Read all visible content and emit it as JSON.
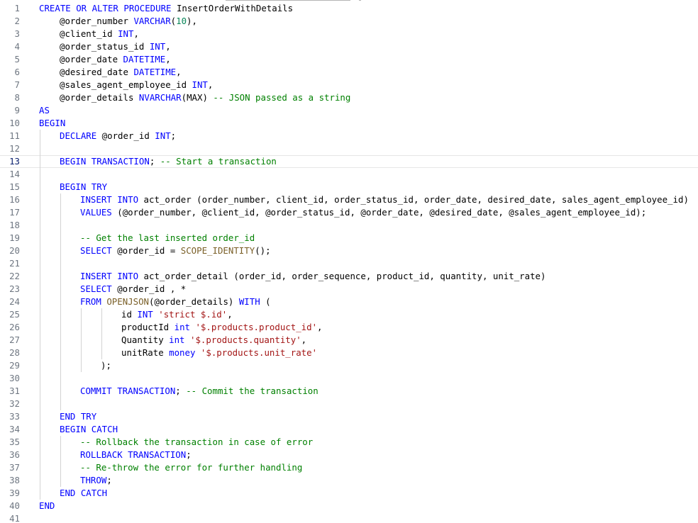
{
  "editor": {
    "current_line": 13,
    "colors": {
      "keyword": "#0000ff",
      "function": "#795e26",
      "number": "#098658",
      "string": "#a31515",
      "comment": "#008000",
      "text": "#000000",
      "line_number": "#6e7681",
      "line_number_active": "#0b216f"
    },
    "lines": [
      {
        "n": "1",
        "indent": 0,
        "tokens": [
          [
            "kw",
            "CREATE OR ALTER PROCEDURE"
          ],
          [
            "id",
            " InsertOrderWithDetails"
          ]
        ]
      },
      {
        "n": "2",
        "indent": 1,
        "tokens": [
          [
            "id",
            "@order_number "
          ],
          [
            "kw",
            "VARCHAR"
          ],
          [
            "op",
            "("
          ],
          [
            "num",
            "10"
          ],
          [
            "op",
            "),"
          ]
        ]
      },
      {
        "n": "3",
        "indent": 1,
        "tokens": [
          [
            "id",
            "@client_id "
          ],
          [
            "kw",
            "INT"
          ],
          [
            "op",
            ","
          ]
        ]
      },
      {
        "n": "4",
        "indent": 1,
        "tokens": [
          [
            "id",
            "@order_status_id "
          ],
          [
            "kw",
            "INT"
          ],
          [
            "op",
            ","
          ]
        ]
      },
      {
        "n": "5",
        "indent": 1,
        "tokens": [
          [
            "id",
            "@order_date "
          ],
          [
            "kw",
            "DATETIME"
          ],
          [
            "op",
            ","
          ]
        ]
      },
      {
        "n": "6",
        "indent": 1,
        "tokens": [
          [
            "id",
            "@desired_date "
          ],
          [
            "kw",
            "DATETIME"
          ],
          [
            "op",
            ","
          ]
        ]
      },
      {
        "n": "7",
        "indent": 1,
        "tokens": [
          [
            "id",
            "@sales_agent_employee_id "
          ],
          [
            "kw",
            "INT"
          ],
          [
            "op",
            ","
          ]
        ]
      },
      {
        "n": "8",
        "indent": 1,
        "tokens": [
          [
            "id",
            "@order_details "
          ],
          [
            "kw",
            "NVARCHAR"
          ],
          [
            "op",
            "("
          ],
          [
            "id",
            "MAX"
          ],
          [
            "op",
            ") "
          ],
          [
            "cm",
            "-- JSON passed as a string"
          ]
        ]
      },
      {
        "n": "9",
        "indent": 0,
        "tokens": [
          [
            "kw",
            "AS"
          ]
        ]
      },
      {
        "n": "10",
        "indent": 0,
        "tokens": [
          [
            "kw",
            "BEGIN"
          ]
        ]
      },
      {
        "n": "11",
        "indent": 1,
        "tokens": [
          [
            "kw",
            "DECLARE"
          ],
          [
            "id",
            " @order_id "
          ],
          [
            "kw",
            "INT"
          ],
          [
            "op",
            ";"
          ]
        ]
      },
      {
        "n": "12",
        "indent": 0,
        "tokens": []
      },
      {
        "n": "13",
        "indent": 1,
        "tokens": [
          [
            "kw",
            "BEGIN TRANSACTION"
          ],
          [
            "op",
            "; "
          ],
          [
            "cm",
            "-- Start a transaction"
          ]
        ]
      },
      {
        "n": "14",
        "indent": 0,
        "tokens": []
      },
      {
        "n": "15",
        "indent": 1,
        "tokens": [
          [
            "kw",
            "BEGIN TRY"
          ]
        ]
      },
      {
        "n": "16",
        "indent": 2,
        "tokens": [
          [
            "kw",
            "INSERT INTO"
          ],
          [
            "id",
            " act_order "
          ],
          [
            "op",
            "("
          ],
          [
            "id",
            "order_number, client_id, order_status_id, order_date, desired_date, sales_agent_employee_id"
          ],
          [
            "op",
            ")"
          ]
        ]
      },
      {
        "n": "17",
        "indent": 2,
        "tokens": [
          [
            "kw",
            "VALUES"
          ],
          [
            "op",
            " ("
          ],
          [
            "id",
            "@order_number, @client_id, @order_status_id, @order_date, @desired_date, @sales_agent_employee_id"
          ],
          [
            "op",
            ");"
          ]
        ]
      },
      {
        "n": "18",
        "indent": 0,
        "tokens": []
      },
      {
        "n": "19",
        "indent": 2,
        "tokens": [
          [
            "cm",
            "-- Get the last inserted order_id"
          ]
        ]
      },
      {
        "n": "20",
        "indent": 2,
        "tokens": [
          [
            "kw",
            "SELECT"
          ],
          [
            "id",
            " @order_id = "
          ],
          [
            "fn",
            "SCOPE_IDENTITY"
          ],
          [
            "op",
            "();"
          ]
        ]
      },
      {
        "n": "21",
        "indent": 0,
        "tokens": []
      },
      {
        "n": "22",
        "indent": 2,
        "tokens": [
          [
            "kw",
            "INSERT INTO"
          ],
          [
            "id",
            " act_order_detail "
          ],
          [
            "op",
            "("
          ],
          [
            "id",
            "order_id, order_sequence, product_id, quantity, unit_rate"
          ],
          [
            "op",
            ")"
          ]
        ]
      },
      {
        "n": "23",
        "indent": 2,
        "tokens": [
          [
            "kw",
            "SELECT"
          ],
          [
            "id",
            " @order_id , *"
          ]
        ]
      },
      {
        "n": "24",
        "indent": 2,
        "tokens": [
          [
            "kw",
            "FROM"
          ],
          [
            "id",
            " "
          ],
          [
            "fn",
            "OPENJSON"
          ],
          [
            "op",
            "("
          ],
          [
            "id",
            "@order_details"
          ],
          [
            "op",
            ") "
          ],
          [
            "kw",
            "WITH"
          ],
          [
            "op",
            " ("
          ]
        ]
      },
      {
        "n": "25",
        "indent": 4,
        "tokens": [
          [
            "id",
            "id "
          ],
          [
            "kw",
            "INT"
          ],
          [
            "id",
            " "
          ],
          [
            "str",
            "'strict $.id'"
          ],
          [
            "op",
            ","
          ]
        ]
      },
      {
        "n": "26",
        "indent": 4,
        "tokens": [
          [
            "id",
            "productId "
          ],
          [
            "kw",
            "int"
          ],
          [
            "id",
            " "
          ],
          [
            "str",
            "'$.products.product_id'"
          ],
          [
            "op",
            ","
          ]
        ]
      },
      {
        "n": "27",
        "indent": 4,
        "tokens": [
          [
            "id",
            "Quantity "
          ],
          [
            "kw",
            "int"
          ],
          [
            "id",
            " "
          ],
          [
            "str",
            "'$.products.quantity'"
          ],
          [
            "op",
            ","
          ]
        ]
      },
      {
        "n": "28",
        "indent": 4,
        "tokens": [
          [
            "id",
            "unitRate "
          ],
          [
            "kw",
            "money"
          ],
          [
            "id",
            " "
          ],
          [
            "str",
            "'$.products.unit_rate'"
          ]
        ]
      },
      {
        "n": "29",
        "indent": 3,
        "tokens": [
          [
            "op",
            ");"
          ]
        ]
      },
      {
        "n": "30",
        "indent": 0,
        "tokens": []
      },
      {
        "n": "31",
        "indent": 2,
        "tokens": [
          [
            "kw",
            "COMMIT TRANSACTION"
          ],
          [
            "op",
            "; "
          ],
          [
            "cm",
            "-- Commit the transaction"
          ]
        ]
      },
      {
        "n": "32",
        "indent": 0,
        "tokens": []
      },
      {
        "n": "33",
        "indent": 1,
        "tokens": [
          [
            "kw",
            "END TRY"
          ]
        ]
      },
      {
        "n": "34",
        "indent": 1,
        "tokens": [
          [
            "kw",
            "BEGIN CATCH"
          ]
        ]
      },
      {
        "n": "35",
        "indent": 2,
        "tokens": [
          [
            "cm",
            "-- Rollback the transaction in case of error"
          ]
        ]
      },
      {
        "n": "36",
        "indent": 2,
        "tokens": [
          [
            "kw",
            "ROLLBACK TRANSACTION"
          ],
          [
            "op",
            ";"
          ]
        ]
      },
      {
        "n": "37",
        "indent": 2,
        "tokens": [
          [
            "cm",
            "-- Re-throw the error for further handling"
          ]
        ]
      },
      {
        "n": "38",
        "indent": 2,
        "tokens": [
          [
            "kw",
            "THROW"
          ],
          [
            "op",
            ";"
          ]
        ]
      },
      {
        "n": "39",
        "indent": 1,
        "tokens": [
          [
            "kw",
            "END CATCH"
          ]
        ]
      },
      {
        "n": "40",
        "indent": 0,
        "tokens": [
          [
            "kw",
            "END"
          ]
        ]
      },
      {
        "n": "41",
        "indent": 0,
        "tokens": []
      }
    ]
  }
}
